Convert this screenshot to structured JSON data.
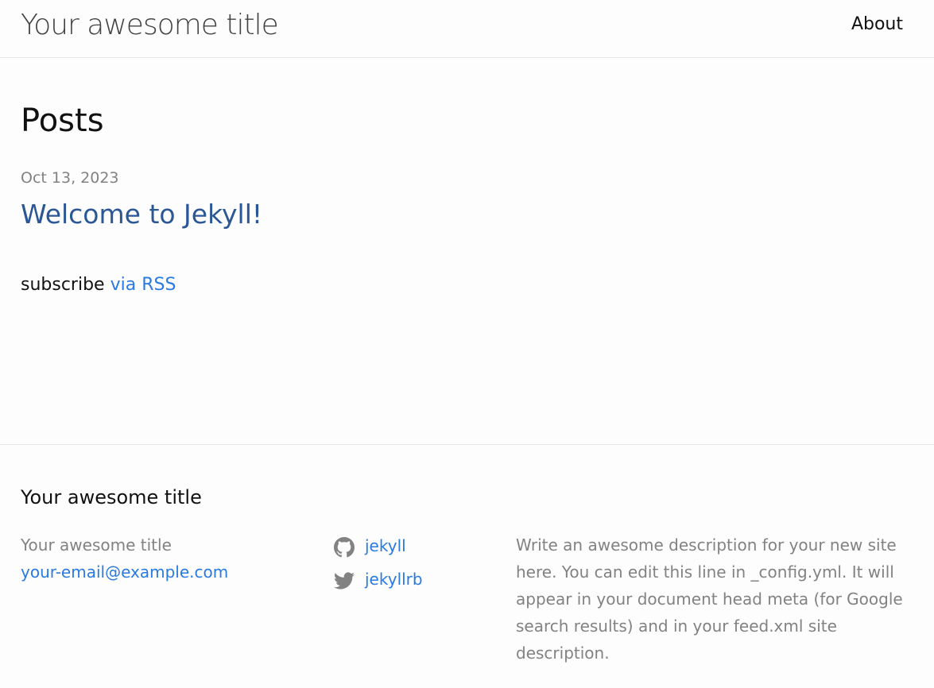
{
  "header": {
    "site_title": "Your awesome title",
    "nav": [
      {
        "label": "About"
      }
    ]
  },
  "main": {
    "heading": "Posts",
    "posts": [
      {
        "date": "Oct 13, 2023",
        "title": "Welcome to Jekyll!"
      }
    ],
    "subscribe_text": "subscribe",
    "subscribe_link": "via RSS"
  },
  "footer": {
    "heading": "Your awesome title",
    "contact": {
      "name": "Your awesome title",
      "email": "your-email@example.com"
    },
    "social": [
      {
        "icon": "github-icon",
        "label": "jekyll"
      },
      {
        "icon": "twitter-icon",
        "label": "jekyllrb"
      }
    ],
    "description": "Write an awesome description for your new site here. You can edit this line in _config.yml. It will appear in your document head meta (for Google search results) and in your feed.xml site description."
  },
  "colors": {
    "link": "#2a7ae2",
    "post_title": "#2b5797",
    "muted": "#828282",
    "text": "#111111",
    "border": "#e8e8e8",
    "background": "#fdfdfd"
  }
}
